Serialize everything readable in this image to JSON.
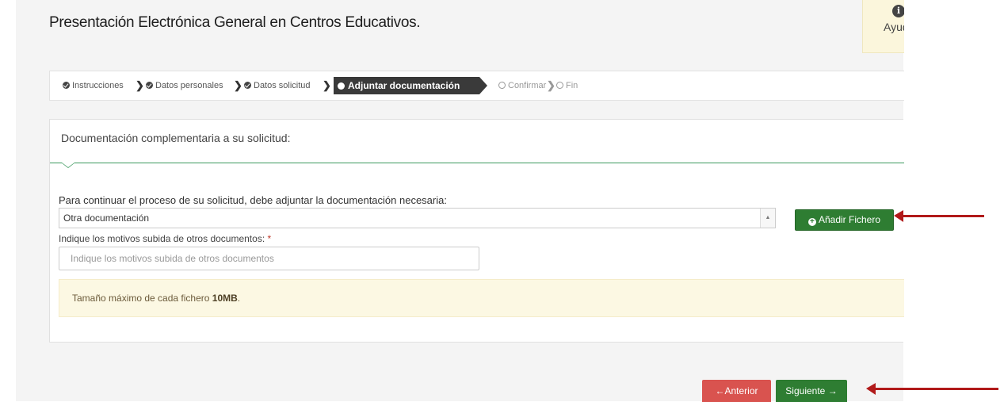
{
  "page": {
    "title": "Presentación Electrónica General en Centros Educativos.",
    "help_label": "Ayuda"
  },
  "breadcrumb": {
    "steps": [
      {
        "label": "Instrucciones",
        "state": "done"
      },
      {
        "label": "Datos personales",
        "state": "done"
      },
      {
        "label": "Datos solicitud",
        "state": "done"
      },
      {
        "label": "Adjuntar documentación",
        "state": "active"
      },
      {
        "label": "Confirmar",
        "state": "pending"
      },
      {
        "label": "Fin",
        "state": "pending"
      }
    ]
  },
  "panel": {
    "heading": "Documentación complementaria a su solicitud:",
    "doc_label": "Para continuar el proceso de su solicitud, debe adjuntar la documentación necesaria:",
    "doc_select_value": "Otra documentación",
    "add_button_label": "Añadir Fichero",
    "motivos_label": "Indique los motivos subida de otros documentos:",
    "required_mark": "*",
    "motivos_placeholder": "Indique los motivos subida de otros documentos",
    "alert_text": "Tamaño máximo de cada fichero ",
    "alert_bold": "10MB",
    "alert_end": "."
  },
  "footer": {
    "prev_label": "Anterior",
    "next_label": "Siguiente"
  },
  "colors": {
    "accent_green": "#2e7d32",
    "danger_red": "#d9534f",
    "annotation_arrow": "#b11a1a",
    "alert_bg": "#fcf8e3"
  },
  "icons": [
    "info-icon",
    "check-circle-icon",
    "chevron-right-icon",
    "circle-outline-icon",
    "plus-circle-icon",
    "arrow-left-icon",
    "arrow-right-icon",
    "select-caret-icon"
  ]
}
